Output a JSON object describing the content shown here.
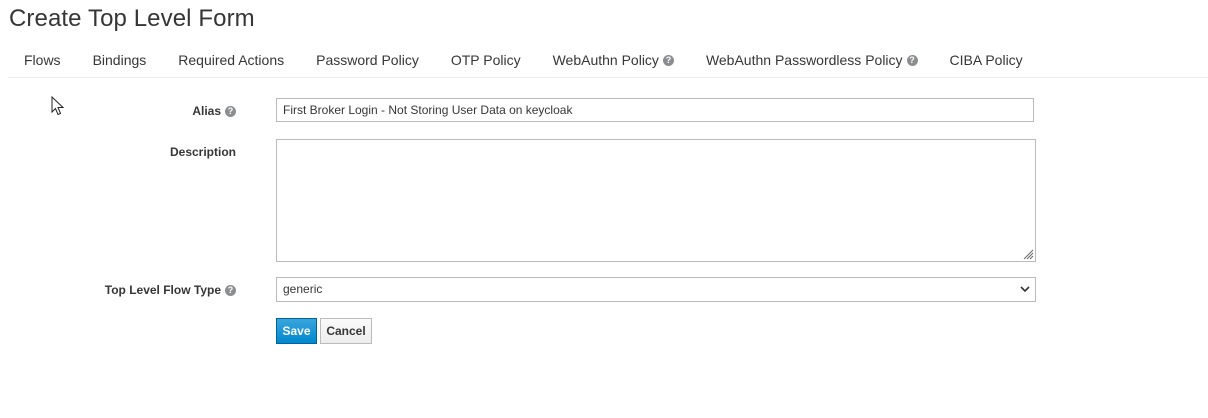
{
  "page": {
    "title": "Create Top Level Form"
  },
  "tabs": [
    {
      "label": "Flows",
      "has_help": false
    },
    {
      "label": "Bindings",
      "has_help": false
    },
    {
      "label": "Required Actions",
      "has_help": false
    },
    {
      "label": "Password Policy",
      "has_help": false
    },
    {
      "label": "OTP Policy",
      "has_help": false
    },
    {
      "label": "WebAuthn Policy",
      "has_help": true
    },
    {
      "label": "WebAuthn Passwordless Policy",
      "has_help": true
    },
    {
      "label": "CIBA Policy",
      "has_help": false
    }
  ],
  "form": {
    "alias": {
      "label": "Alias",
      "value": "First Broker Login - Not Storing User Data on keycloak"
    },
    "description": {
      "label": "Description",
      "value": ""
    },
    "flow_type": {
      "label": "Top Level Flow Type",
      "selected": "generic"
    }
  },
  "buttons": {
    "save_label": "Save",
    "cancel_label": "Cancel"
  },
  "icons": {
    "help": "help-icon",
    "select_caret": "chevron-down-icon",
    "cursor": "mouse-pointer-icon"
  },
  "colors": {
    "primary": "#0088ce",
    "primary_border": "#00659c",
    "text": "#363636",
    "border": "#bbbbbb",
    "help_icon": "#8b8d8f"
  }
}
